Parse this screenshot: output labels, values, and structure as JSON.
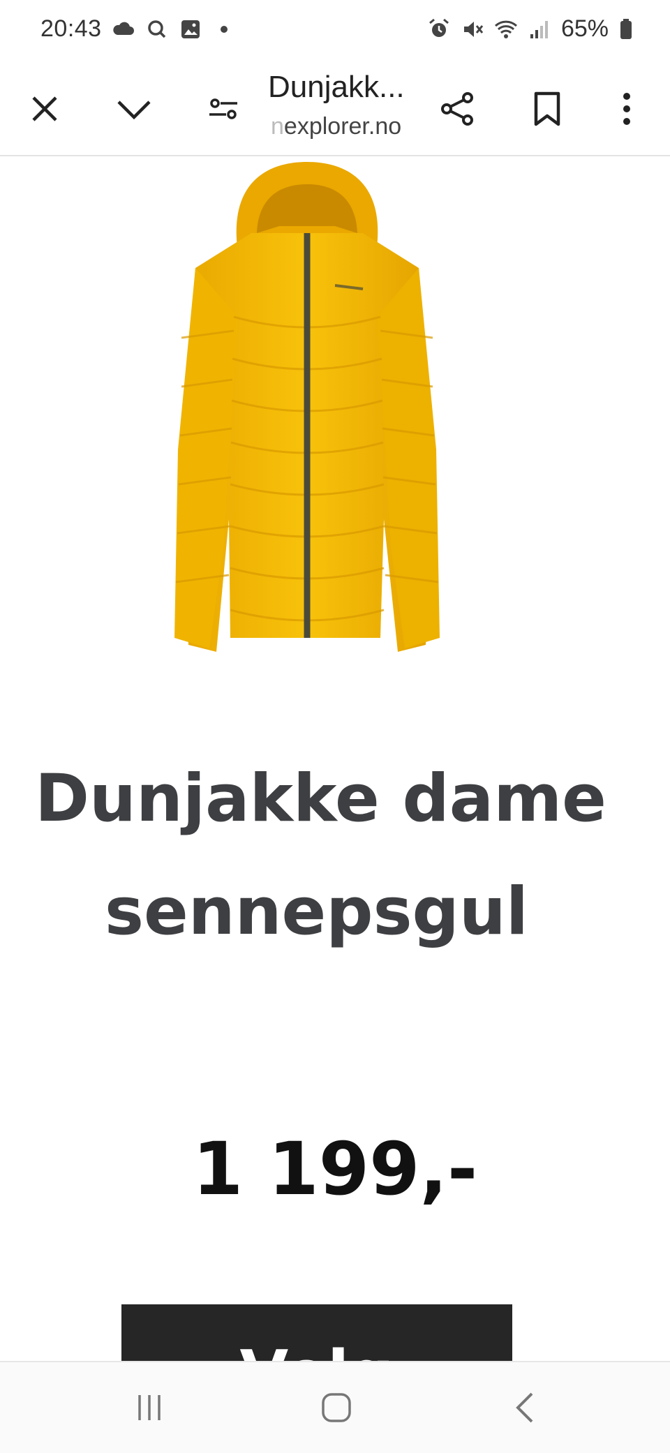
{
  "status_bar": {
    "time": "20:43",
    "battery_percent": "65%",
    "left_icons": [
      "cloud-icon",
      "search-q-icon",
      "gallery-icon",
      "dot-icon"
    ],
    "right_icons": [
      "alarm-icon",
      "mute-icon",
      "wifi-icon",
      "signal-icon",
      "battery-icon"
    ]
  },
  "browser": {
    "title": "Dunjakk...",
    "url_fade": "n",
    "url": "explorer.no",
    "buttons": [
      "close-icon",
      "chevron-down-icon",
      "tune-icon",
      "share-icon",
      "bookmark-icon",
      "more-vert-icon"
    ]
  },
  "product": {
    "name_line1": "Dunjakke dame",
    "name_line2": "sennepsgul",
    "price": "1 199,-",
    "button_label": "Velg",
    "jacket_color": "#f2b400"
  },
  "nav_bar": {
    "buttons": [
      "recent-apps-icon",
      "home-icon",
      "back-icon"
    ]
  }
}
